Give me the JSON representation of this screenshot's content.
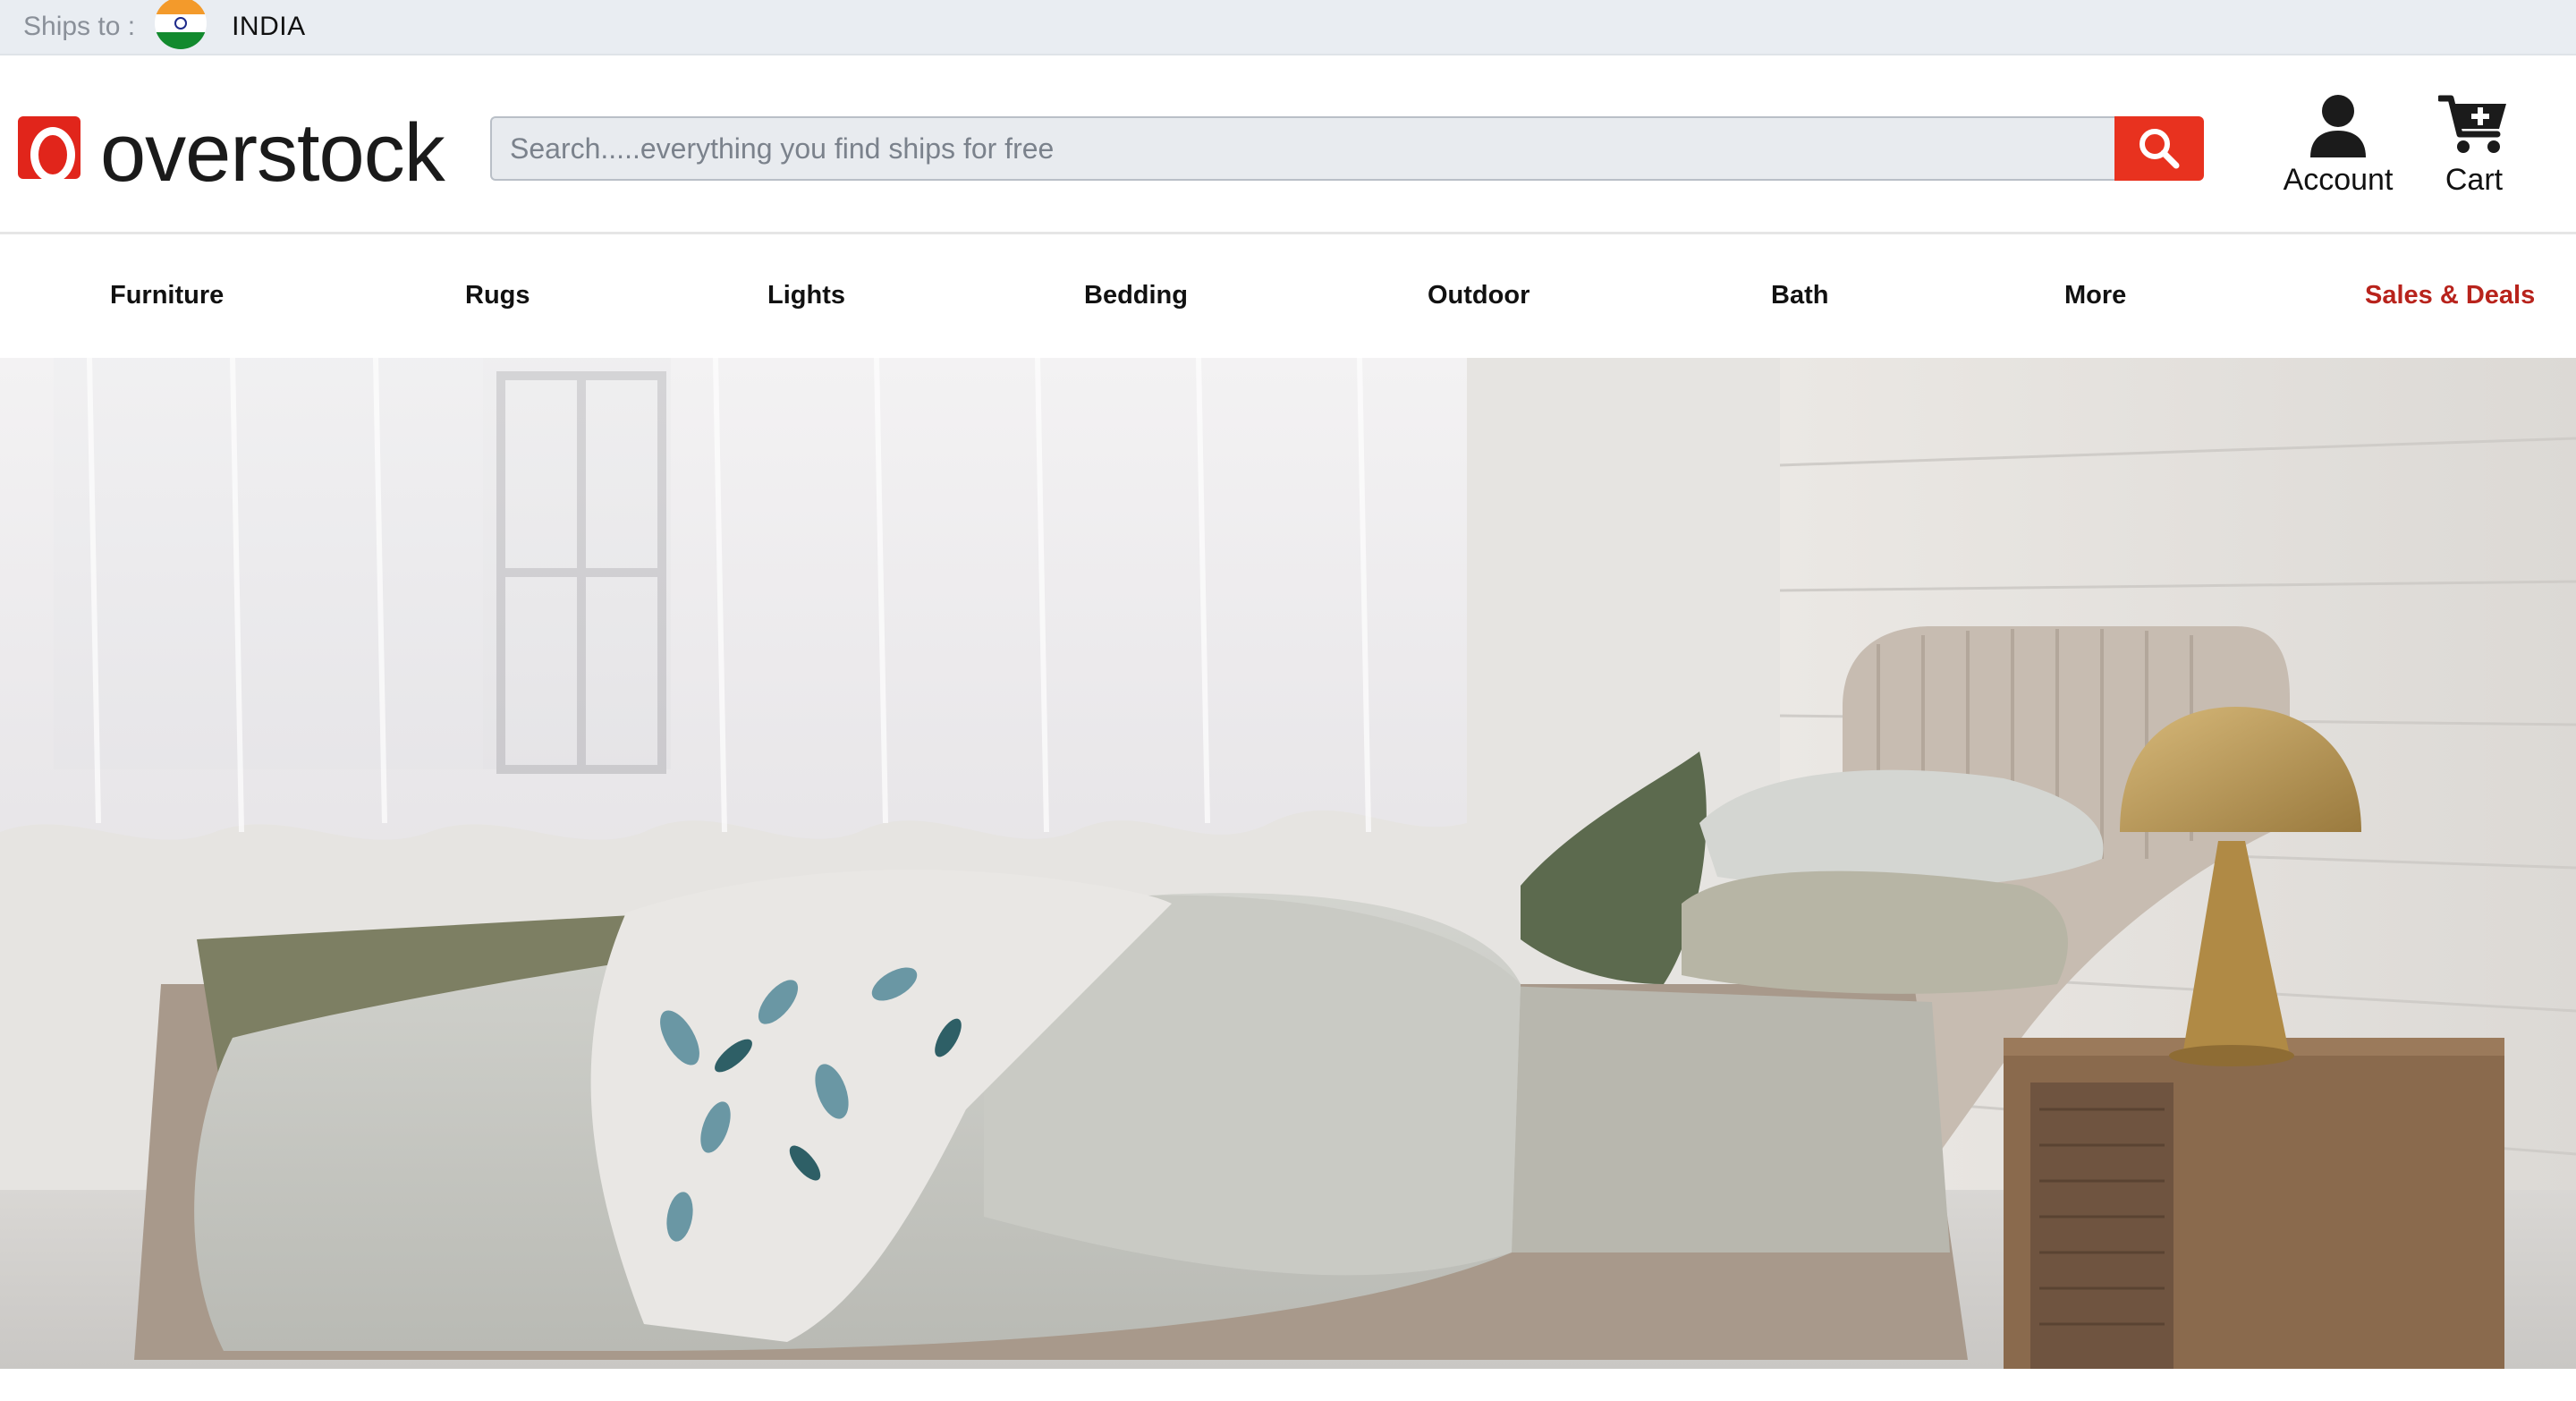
{
  "ships_bar": {
    "label": "Ships to :",
    "flag_icon": "india-flag-icon",
    "country": "INDIA"
  },
  "header": {
    "logo_text": "overstock",
    "brand_color": "#e1251b",
    "search": {
      "placeholder": "Search.....everything you find ships for free",
      "value": "",
      "button_icon": "search-icon",
      "button_color": "#e8321f"
    },
    "account": {
      "label": "Account",
      "icon": "user-icon"
    },
    "cart": {
      "label": "Cart",
      "icon": "cart-plus-icon"
    }
  },
  "nav": {
    "items": [
      {
        "label": "Furniture"
      },
      {
        "label": "Rugs"
      },
      {
        "label": "Lights"
      },
      {
        "label": "Bedding"
      },
      {
        "label": "Outdoor"
      },
      {
        "label": "Bath"
      },
      {
        "label": "More"
      },
      {
        "label": "Sales & Deals",
        "color": "#b8231c"
      }
    ]
  },
  "hero": {
    "image_subject": "bedroom-hero-image"
  }
}
